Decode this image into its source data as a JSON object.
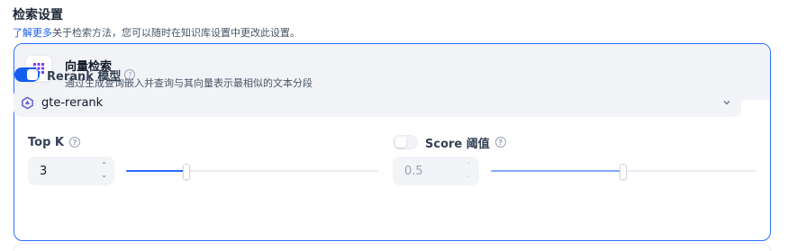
{
  "section": {
    "title": "检索设置",
    "learn_more": "了解更多",
    "description_rest": "关于检索方法，您可以随时在知识库设置中更改此设置。"
  },
  "card": {
    "icon": "vector-grid-icon",
    "title": "向量检索",
    "subtitle": "通过生成查询嵌入并查询与其向量表示最相似的文本分段"
  },
  "rerank": {
    "enabled": true,
    "label": "Rerank 模型",
    "help_icon": "help-circle-icon",
    "model": {
      "icon": "gte-model-icon",
      "name": "gte-rerank"
    }
  },
  "top_k": {
    "label": "Top K",
    "value": "3",
    "slider_fraction": 0.23
  },
  "score_threshold": {
    "enabled": false,
    "label": "Score 阈值",
    "value": "0.5",
    "slider_fraction": 0.5
  },
  "colors": {
    "accent": "#155eef",
    "card_border": "#296dff",
    "card_header_bg": "#f2f3f7"
  }
}
